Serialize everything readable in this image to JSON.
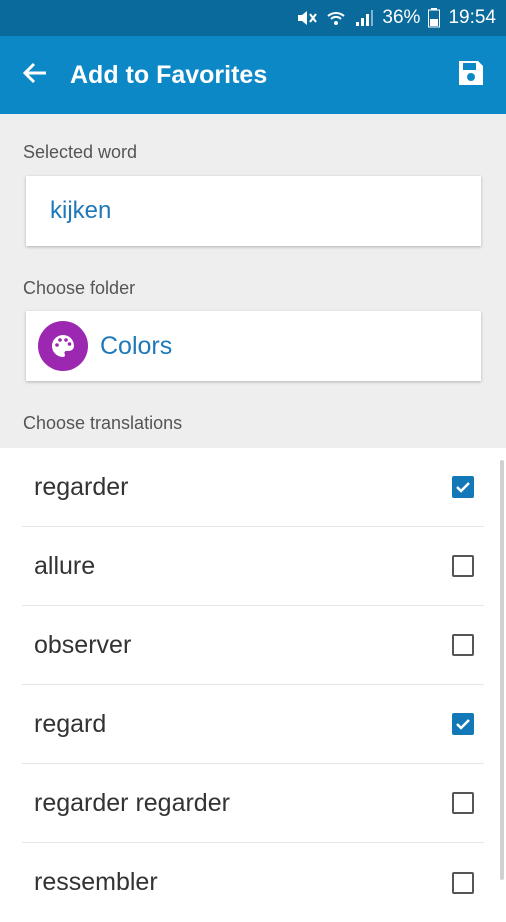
{
  "status_bar": {
    "battery_percent": "36%",
    "time": "19:54",
    "icons": [
      "mute-icon",
      "wifi-icon",
      "signal-icon",
      "battery-icon"
    ]
  },
  "app_bar": {
    "title": "Add to Favorites",
    "back_icon": "arrow-left-icon",
    "save_icon": "save-icon"
  },
  "selected_word": {
    "label": "Selected word",
    "value": "kijken"
  },
  "folder": {
    "label": "Choose folder",
    "name": "Colors",
    "icon": "palette-icon"
  },
  "translations": {
    "label": "Choose translations",
    "items": [
      {
        "label": "regarder",
        "checked": true
      },
      {
        "label": "allure",
        "checked": false
      },
      {
        "label": "observer",
        "checked": false
      },
      {
        "label": "regard",
        "checked": true
      },
      {
        "label": "regarder regarder",
        "checked": false
      },
      {
        "label": "ressembler",
        "checked": false
      }
    ]
  },
  "colors": {
    "app_bar": "#0d88c6",
    "status_bar": "#0a6a9c",
    "accent_text": "#1f79b8",
    "folder_icon_bg": "#9c27b0",
    "checkbox_checked": "#1378b8"
  }
}
